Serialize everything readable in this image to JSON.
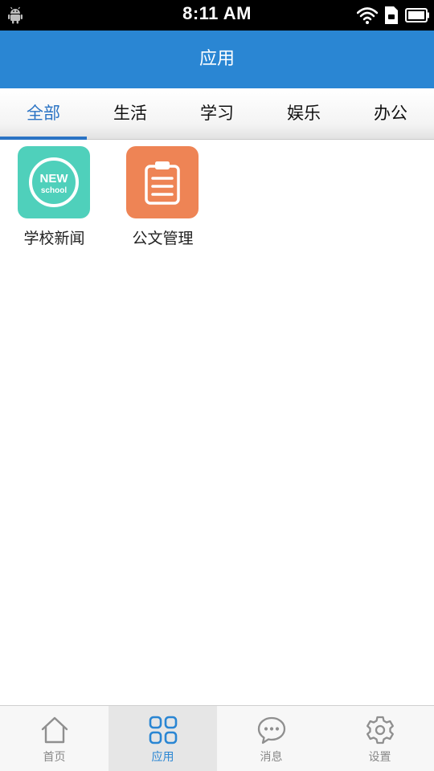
{
  "status_bar": {
    "time": "8:11 AM",
    "icons": [
      "android-icon",
      "wifi-icon",
      "sim-card-icon",
      "battery-icon"
    ]
  },
  "header": {
    "title": "应用"
  },
  "tabs": [
    {
      "label": "全部",
      "active": true
    },
    {
      "label": "生活",
      "active": false
    },
    {
      "label": "学习",
      "active": false
    },
    {
      "label": "娱乐",
      "active": false
    },
    {
      "label": "办公",
      "active": false
    }
  ],
  "apps": [
    {
      "label": "学校新闻",
      "icon": "new-school-icon",
      "color": "#4fd0bb",
      "logo_text_top": "NEW",
      "logo_text_bottom": "school"
    },
    {
      "label": "公文管理",
      "icon": "clipboard-icon",
      "color": "#ee8455"
    }
  ],
  "bottom_nav": [
    {
      "label": "首页",
      "icon": "home-icon",
      "active": false
    },
    {
      "label": "应用",
      "icon": "apps-grid-icon",
      "active": true
    },
    {
      "label": "消息",
      "icon": "chat-bubble-icon",
      "active": false
    },
    {
      "label": "设置",
      "icon": "gear-icon",
      "active": false
    }
  ],
  "colors": {
    "accent": "#2a86d3",
    "tab_active": "#2a73c4",
    "nav_inactive": "#888888"
  }
}
